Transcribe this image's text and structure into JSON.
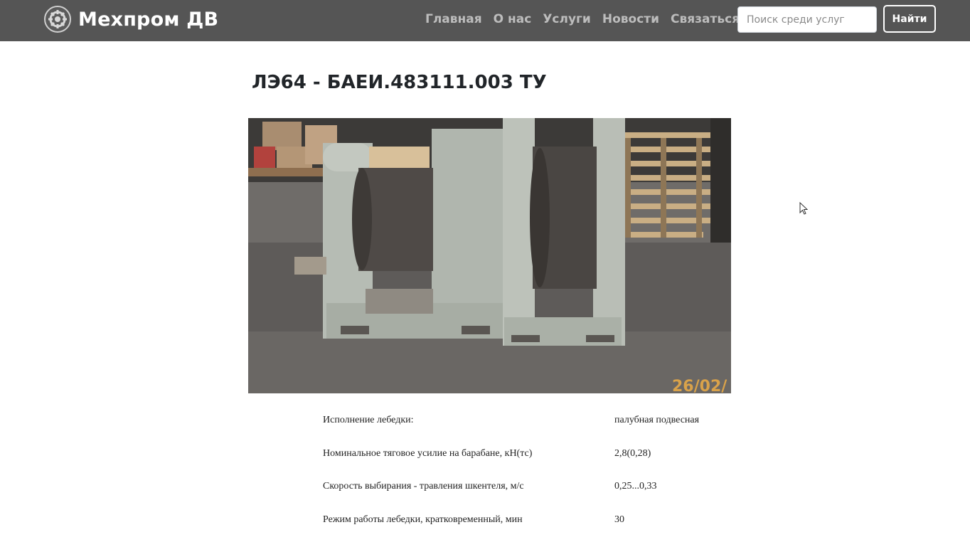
{
  "brand": {
    "name": "Мехпром ДВ",
    "logo_icon": "gear-icon"
  },
  "nav": {
    "items": [
      {
        "label": "Главная"
      },
      {
        "label": "О нас"
      },
      {
        "label": "Услуги"
      },
      {
        "label": "Новости"
      },
      {
        "label": "Связаться"
      }
    ]
  },
  "search": {
    "placeholder": "Поиск среди услуг",
    "value": "",
    "button_label": "Найти"
  },
  "colors": {
    "navbar_bg": "#555555",
    "nav_link": "#bdbdbd",
    "title": "#212529"
  },
  "product": {
    "title": "ЛЭ64 - БАЕИ.483111.003 ТУ",
    "photo_stamp": "26/02/"
  },
  "specs": [
    {
      "label": "Исполнение лебедки:",
      "value": "палубная подвесная"
    },
    {
      "label": "Номинальное  тяговое  усилие  на  барабане, кН(тс)",
      "value": " 2,8(0,28)"
    },
    {
      "label": "Скорость  выбирания - травления  шкентеля, м/с",
      "value": "  0,25...0,33"
    },
    {
      "label": "Режим  работы  лебедки, кратковременный, мин",
      "value": " 30"
    }
  ]
}
